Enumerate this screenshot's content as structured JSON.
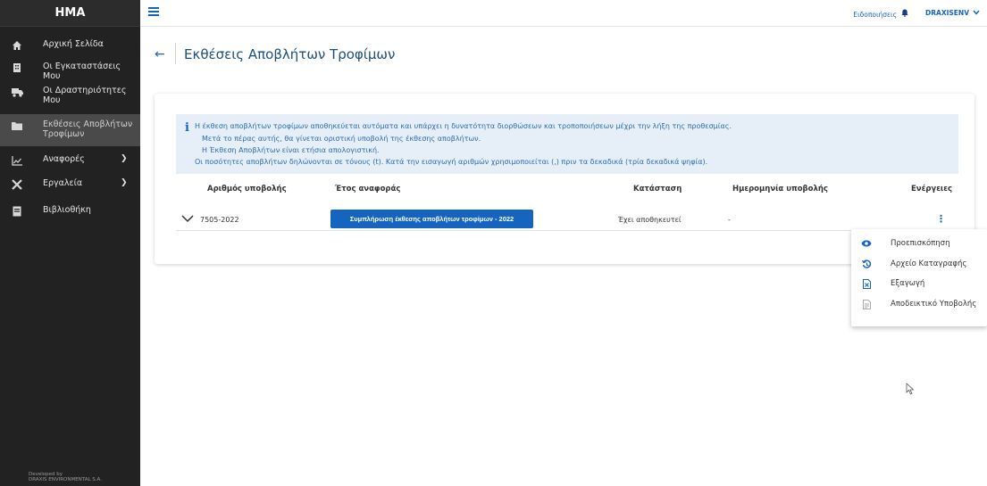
{
  "app": {
    "brand": "HMA"
  },
  "sidebar": {
    "items": [
      {
        "label": "Αρχική Σελίδα",
        "icon": "home-icon"
      },
      {
        "label": "Οι Εγκαταστάσεις Μου",
        "icon": "building-icon"
      },
      {
        "label": "Οι Δραστηριότητες Μου",
        "icon": "truck-icon"
      },
      {
        "label": "Εκθέσεις Αποβλήτων Τροφίμων",
        "icon": "folder-icon",
        "active": true
      },
      {
        "label": "Αναφορές",
        "icon": "chart-icon"
      },
      {
        "label": "Εργαλεία",
        "icon": "tools-icon"
      },
      {
        "label": "Βιβλιοθήκη",
        "icon": "book-icon"
      }
    ],
    "developed_by": "Developed by",
    "developer": "DRAXIS ENVIRONMENTAL S.A."
  },
  "topbar": {
    "notifications_label": "Ειδοποιήσεις",
    "user_name": "DRAXISENV"
  },
  "page": {
    "title": "Εκθέσεις Αποβλήτων Τροφίμων"
  },
  "info": {
    "lines": [
      "Η έκθεση αποβλήτων τροφίμων αποθηκεύεται αυτόματα και υπάρχει η δυνατότητα διορθώσεων και τροποποιήσεων μέχρι την λήξη της προθεσμίας.",
      "Μετά το πέρας αυτής, θα γίνεται οριστική υποβολή της έκθεσης αποβλήτων.",
      "Η Έκθεση Αποβλήτων είναι ετήσια απολογιστική.",
      "Οι ποσότητες αποβλήτων δηλώνονται σε τόνους (t). Κατά την εισαγωγή αριθμών χρησιμοποιείται (,) πριν τα δεκαδικά (τρία δεκαδικά ψηφία)."
    ]
  },
  "table": {
    "headers": {
      "submission_number": "Αριθμός υποβολής",
      "year": "Έτος αναφοράς",
      "status": "Κατάσταση",
      "date": "Ημερομηνία υποβολής",
      "actions": "Ενέργειες"
    },
    "rows": [
      {
        "submission_number": "7505-2022",
        "action_button": "Συμπλήρωση έκθεσης αποβλήτων τροφίμων - 2022",
        "status": "Έχει αποθηκευτεί",
        "date": "-"
      }
    ]
  },
  "menu": {
    "items": [
      {
        "label": "Προεπισκόπηση",
        "icon": "eye-icon"
      },
      {
        "label": "Αρχείο Καταγραφής",
        "icon": "history-icon"
      },
      {
        "label": "Εξαγωγή",
        "icon": "export-file-icon"
      },
      {
        "label": "Αποδεικτικό Υποβολής",
        "icon": "receipt-icon",
        "disabled": true
      }
    ]
  },
  "colors": {
    "primary": "#1565c0",
    "sidebar_bg": "#222222",
    "sidebar_active": "#4a4a4a",
    "info_bg": "#e6eef8"
  }
}
